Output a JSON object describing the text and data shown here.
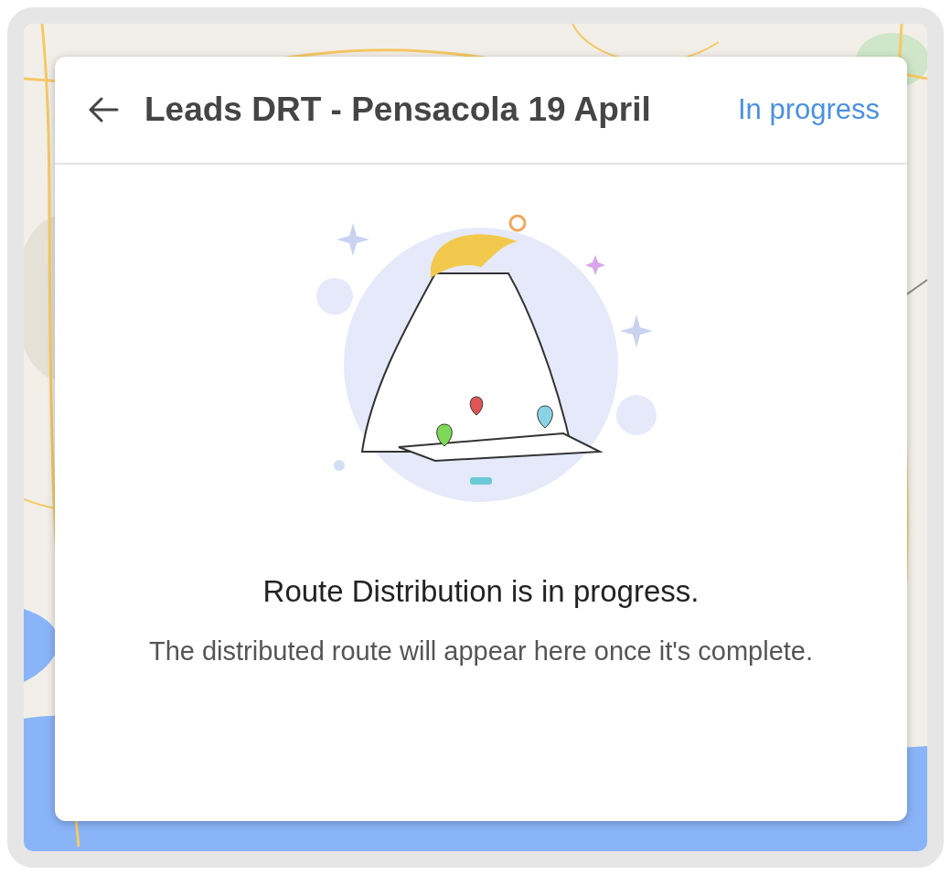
{
  "header": {
    "title": "Leads DRT - Pensacola 19 April",
    "status": "In progress"
  },
  "message": {
    "heading": "Route Distribution is in progress.",
    "body": "The distributed route will appear here once it's complete."
  }
}
